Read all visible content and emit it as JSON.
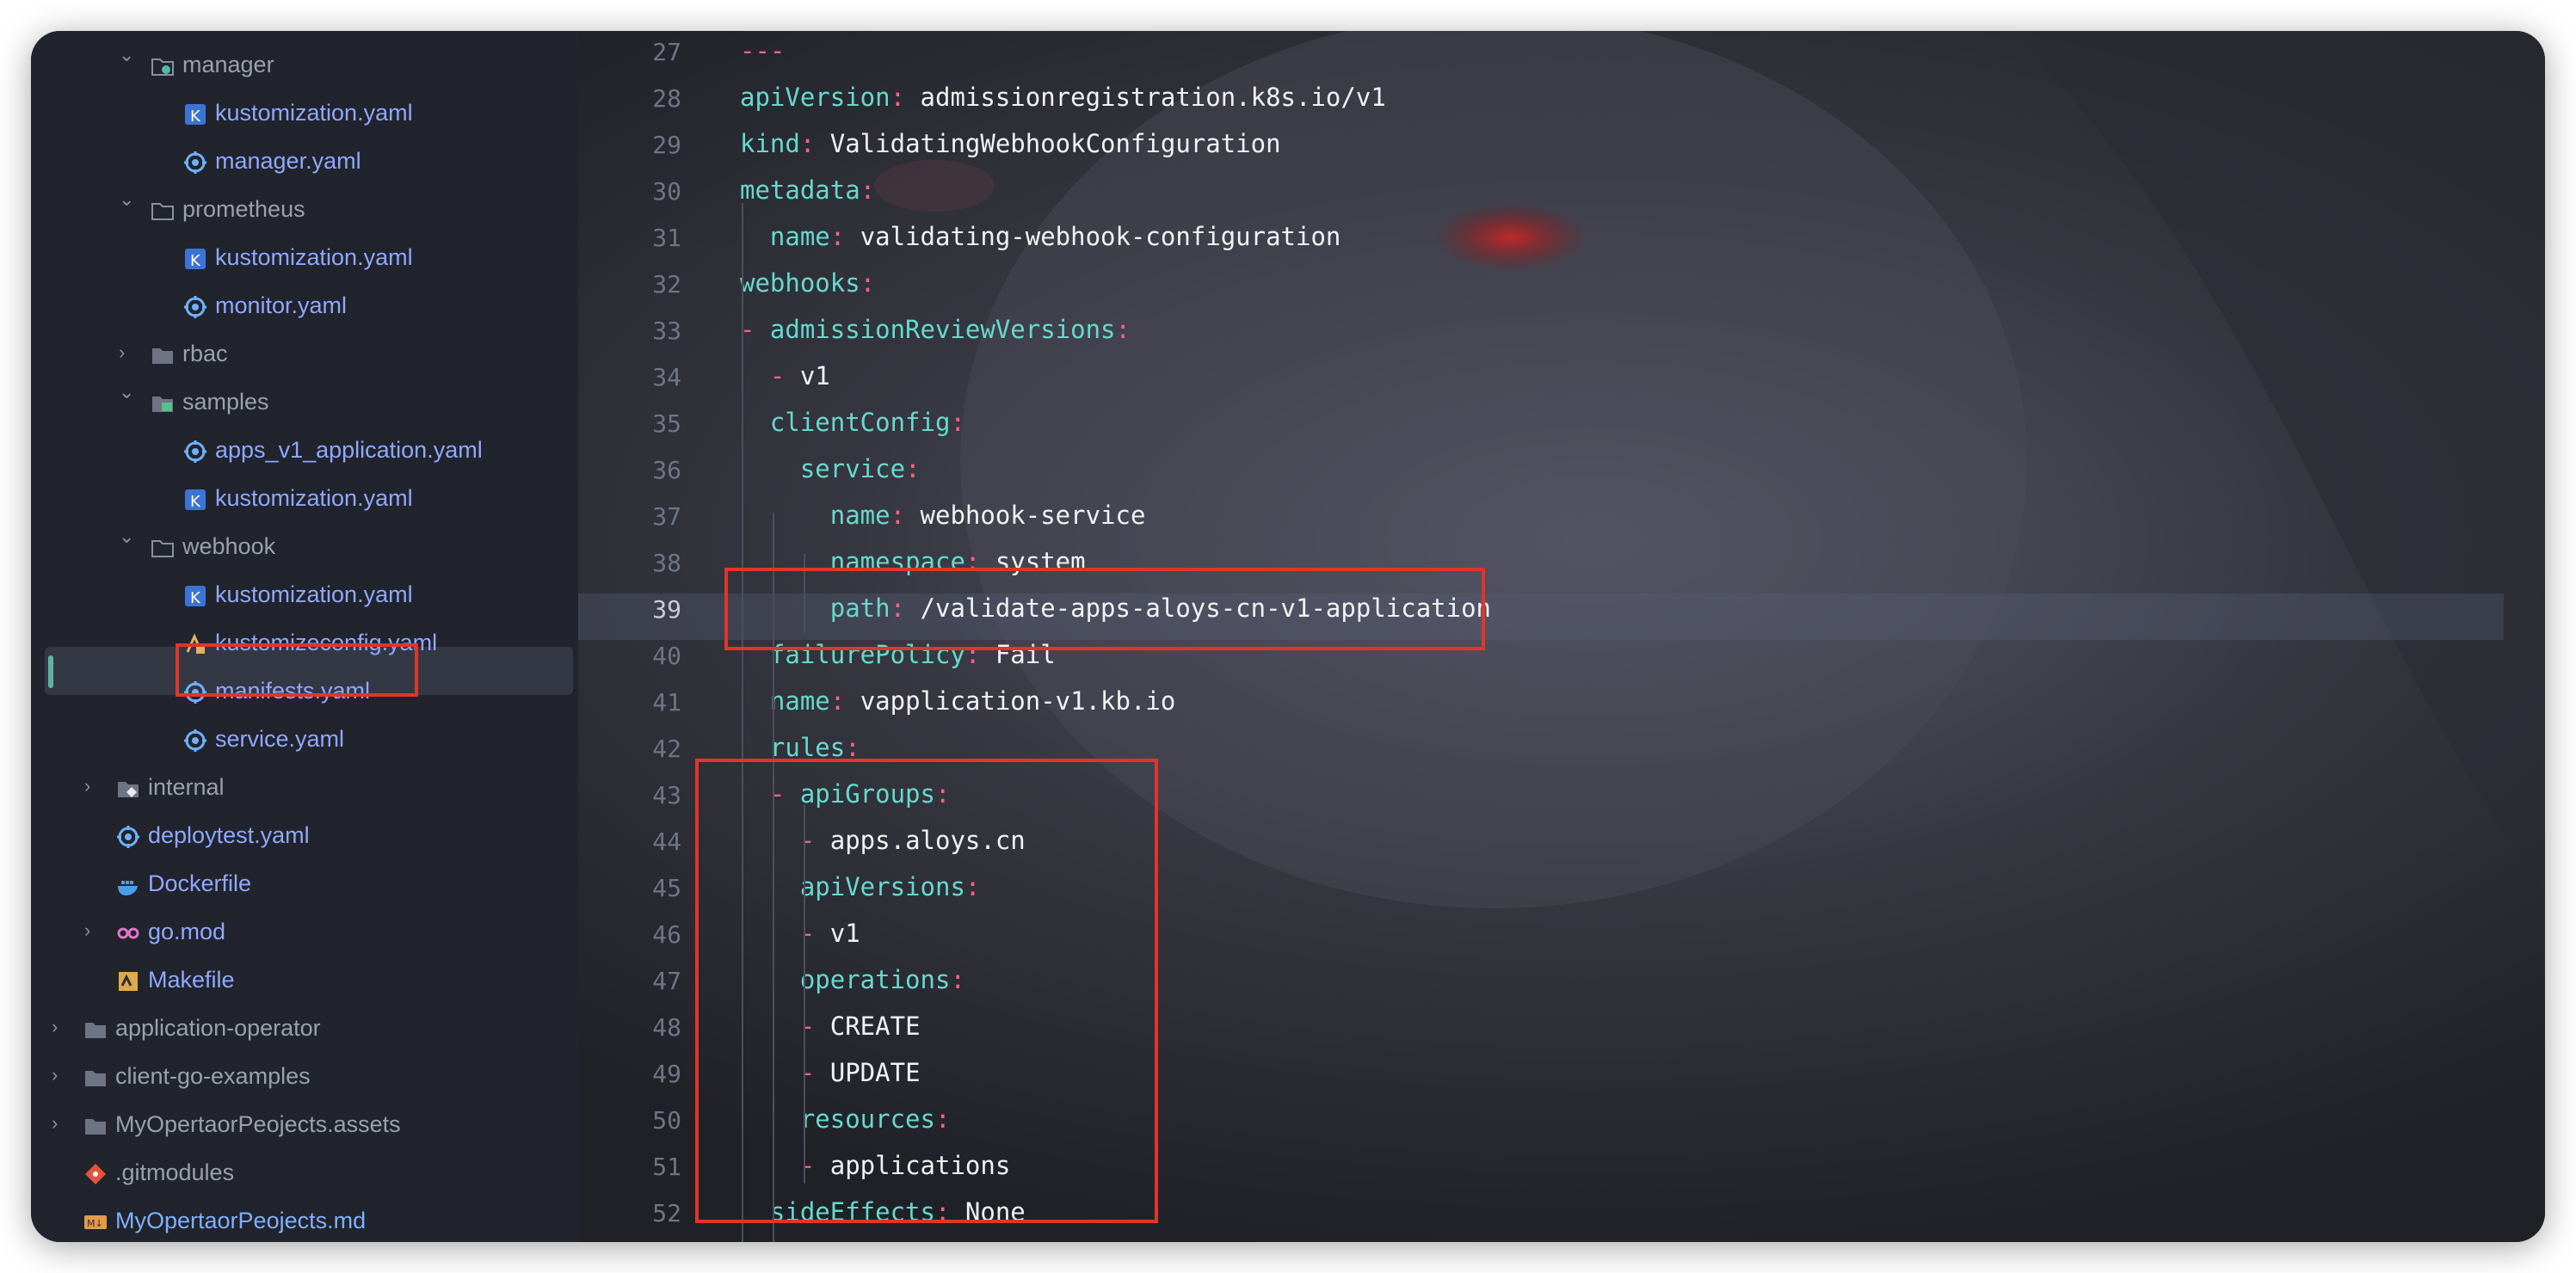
{
  "tree": [
    {
      "label": "manager",
      "kind": "dir",
      "icon": "folder-gear-icon",
      "open": true,
      "depth": 3
    },
    {
      "label": "kustomization.yaml",
      "kind": "file",
      "icon": "kustomize-k-icon",
      "depth": 4
    },
    {
      "label": "manager.yaml",
      "kind": "file",
      "icon": "yaml-gear-icon",
      "depth": 4
    },
    {
      "label": "prometheus",
      "kind": "dir",
      "icon": "folder-outline-icon",
      "open": true,
      "depth": 3
    },
    {
      "label": "kustomization.yaml",
      "kind": "file",
      "icon": "kustomize-k-icon",
      "depth": 4
    },
    {
      "label": "monitor.yaml",
      "kind": "file",
      "icon": "yaml-gear-icon",
      "depth": 4
    },
    {
      "label": "rbac",
      "kind": "dir",
      "icon": "folder-icon",
      "open": false,
      "depth": 3
    },
    {
      "label": "samples",
      "kind": "dir",
      "icon": "folder-green-icon",
      "open": true,
      "depth": 3
    },
    {
      "label": "apps_v1_application.yaml",
      "kind": "file",
      "icon": "yaml-gear-icon",
      "depth": 4
    },
    {
      "label": "kustomization.yaml",
      "kind": "file",
      "icon": "kustomize-k-icon",
      "depth": 4
    },
    {
      "label": "webhook",
      "kind": "dir",
      "icon": "folder-outline-icon",
      "open": true,
      "depth": 3
    },
    {
      "label": "kustomization.yaml",
      "kind": "file",
      "icon": "kustomize-k-icon",
      "depth": 4
    },
    {
      "label": "kustomizeconfig.yaml",
      "kind": "file",
      "icon": "yaml-config-icon",
      "depth": 4
    },
    {
      "label": "manifests.yaml",
      "kind": "file",
      "icon": "yaml-gear-icon",
      "depth": 4,
      "selected": true
    },
    {
      "label": "service.yaml",
      "kind": "file",
      "icon": "yaml-gear-icon",
      "depth": 4
    },
    {
      "label": "internal",
      "kind": "dir",
      "icon": "folder-special-icon",
      "open": false,
      "depth": 2
    },
    {
      "label": "deploytest.yaml",
      "kind": "file",
      "icon": "yaml-gear-icon",
      "depth": 2
    },
    {
      "label": "Dockerfile",
      "kind": "file",
      "icon": "docker-icon",
      "depth": 2
    },
    {
      "label": "go.mod",
      "kind": "file",
      "icon": "go-mod-icon",
      "depth": 2,
      "chevron": true
    },
    {
      "label": "Makefile",
      "kind": "file",
      "icon": "makefile-icon",
      "depth": 2
    },
    {
      "label": "application-operator",
      "kind": "dir",
      "icon": "folder-icon",
      "open": false,
      "depth": 1
    },
    {
      "label": "client-go-examples",
      "kind": "dir",
      "icon": "folder-icon",
      "open": false,
      "depth": 1
    },
    {
      "label": "MyOpertaorPeojects.assets",
      "kind": "dir",
      "icon": "folder-icon",
      "open": false,
      "depth": 1
    },
    {
      "label": ".gitmodules",
      "kind": "file",
      "icon": "git-icon",
      "depth": 1,
      "style": "dir"
    },
    {
      "label": "MyOpertaorPeojects.md",
      "kind": "md",
      "icon": "markdown-icon",
      "depth": 1
    }
  ],
  "editor": {
    "current_line": 39,
    "lines": [
      {
        "n": "27",
        "parts": [
          [
            "c",
            "---"
          ]
        ]
      },
      {
        "n": "28",
        "parts": [
          [
            "k",
            "apiVersion"
          ],
          [
            "c",
            ": "
          ],
          [
            "v",
            "admissionregistration.k8s.io/v1"
          ]
        ]
      },
      {
        "n": "29",
        "parts": [
          [
            "k",
            "kind"
          ],
          [
            "c",
            ": "
          ],
          [
            "v",
            "ValidatingWebhookConfiguration"
          ]
        ]
      },
      {
        "n": "30",
        "parts": [
          [
            "k",
            "metadata"
          ],
          [
            "c",
            ":"
          ]
        ]
      },
      {
        "n": "31",
        "parts": [
          [
            "v",
            "  "
          ],
          [
            "k",
            "name"
          ],
          [
            "c",
            ": "
          ],
          [
            "v",
            "validating-webhook-configuration"
          ]
        ]
      },
      {
        "n": "32",
        "parts": [
          [
            "k",
            "webhooks"
          ],
          [
            "c",
            ":"
          ]
        ]
      },
      {
        "n": "33",
        "parts": [
          [
            "c",
            "- "
          ],
          [
            "k",
            "admissionReviewVersions"
          ],
          [
            "c",
            ":"
          ]
        ]
      },
      {
        "n": "34",
        "parts": [
          [
            "v",
            "  "
          ],
          [
            "c",
            "- "
          ],
          [
            "v",
            "v1"
          ]
        ]
      },
      {
        "n": "35",
        "parts": [
          [
            "v",
            "  "
          ],
          [
            "k",
            "clientConfig"
          ],
          [
            "c",
            ":"
          ]
        ]
      },
      {
        "n": "36",
        "parts": [
          [
            "v",
            "    "
          ],
          [
            "k",
            "service"
          ],
          [
            "c",
            ":"
          ]
        ]
      },
      {
        "n": "37",
        "parts": [
          [
            "v",
            "      "
          ],
          [
            "k",
            "name"
          ],
          [
            "c",
            ": "
          ],
          [
            "v",
            "webhook-service"
          ]
        ]
      },
      {
        "n": "38",
        "parts": [
          [
            "v",
            "      "
          ],
          [
            "k",
            "namespace"
          ],
          [
            "c",
            ": "
          ],
          [
            "v",
            "system"
          ]
        ]
      },
      {
        "n": "39",
        "parts": [
          [
            "v",
            "      "
          ],
          [
            "k",
            "path"
          ],
          [
            "c",
            ": "
          ],
          [
            "v",
            "/validate-apps-aloys-cn-v1-application"
          ]
        ]
      },
      {
        "n": "40",
        "parts": [
          [
            "v",
            "  "
          ],
          [
            "k",
            "failurePolicy"
          ],
          [
            "c",
            ": "
          ],
          [
            "v",
            "Fail"
          ]
        ]
      },
      {
        "n": "41",
        "parts": [
          [
            "v",
            "  "
          ],
          [
            "k",
            "name"
          ],
          [
            "c",
            ": "
          ],
          [
            "v",
            "vapplication-v1.kb.io"
          ]
        ]
      },
      {
        "n": "42",
        "parts": [
          [
            "v",
            "  "
          ],
          [
            "k",
            "rules"
          ],
          [
            "c",
            ":"
          ]
        ]
      },
      {
        "n": "43",
        "parts": [
          [
            "v",
            "  "
          ],
          [
            "c",
            "- "
          ],
          [
            "k",
            "apiGroups"
          ],
          [
            "c",
            ":"
          ]
        ]
      },
      {
        "n": "44",
        "parts": [
          [
            "v",
            "    "
          ],
          [
            "c",
            "- "
          ],
          [
            "v",
            "apps.aloys.cn"
          ]
        ]
      },
      {
        "n": "45",
        "parts": [
          [
            "v",
            "    "
          ],
          [
            "k",
            "apiVersions"
          ],
          [
            "c",
            ":"
          ]
        ]
      },
      {
        "n": "46",
        "parts": [
          [
            "v",
            "    "
          ],
          [
            "c",
            "- "
          ],
          [
            "v",
            "v1"
          ]
        ]
      },
      {
        "n": "47",
        "parts": [
          [
            "v",
            "    "
          ],
          [
            "k",
            "operations"
          ],
          [
            "c",
            ":"
          ]
        ]
      },
      {
        "n": "48",
        "parts": [
          [
            "v",
            "    "
          ],
          [
            "c",
            "- "
          ],
          [
            "v",
            "CREATE"
          ]
        ]
      },
      {
        "n": "49",
        "parts": [
          [
            "v",
            "    "
          ],
          [
            "c",
            "- "
          ],
          [
            "v",
            "UPDATE"
          ]
        ]
      },
      {
        "n": "50",
        "parts": [
          [
            "v",
            "    "
          ],
          [
            "k",
            "resources"
          ],
          [
            "c",
            ":"
          ]
        ]
      },
      {
        "n": "51",
        "parts": [
          [
            "v",
            "    "
          ],
          [
            "c",
            "- "
          ],
          [
            "v",
            "applications"
          ]
        ]
      },
      {
        "n": "52",
        "parts": [
          [
            "v",
            "  "
          ],
          [
            "k",
            "sideEffects"
          ],
          [
            "c",
            ": "
          ],
          [
            "v",
            "None"
          ]
        ]
      }
    ]
  },
  "toolbar": [
    "open-in-icon",
    "pin-icon",
    "refresh-icon",
    "settings-sliders-icon"
  ],
  "colors": {
    "accent": "#e0352b",
    "key": "#66d9cf",
    "punct": "#ff5f87",
    "scroll": "#c9689d"
  }
}
